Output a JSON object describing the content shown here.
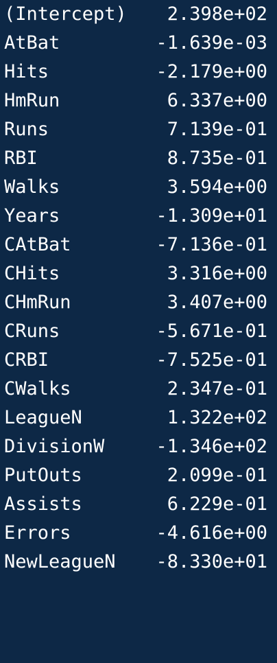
{
  "coefficients": [
    {
      "term": "(Intercept)",
      "value": "2.398e+02"
    },
    {
      "term": "AtBat",
      "value": "-1.639e-03"
    },
    {
      "term": "Hits",
      "value": "-2.179e+00"
    },
    {
      "term": "HmRun",
      "value": "6.337e+00"
    },
    {
      "term": "Runs",
      "value": "7.139e-01"
    },
    {
      "term": "RBI",
      "value": "8.735e-01"
    },
    {
      "term": "Walks",
      "value": "3.594e+00"
    },
    {
      "term": "Years",
      "value": "-1.309e+01"
    },
    {
      "term": "CAtBat",
      "value": "-7.136e-01"
    },
    {
      "term": "CHits",
      "value": "3.316e+00"
    },
    {
      "term": "CHmRun",
      "value": "3.407e+00"
    },
    {
      "term": "CRuns",
      "value": "-5.671e-01"
    },
    {
      "term": "CRBI",
      "value": "-7.525e-01"
    },
    {
      "term": "CWalks",
      "value": "2.347e-01"
    },
    {
      "term": "LeagueN",
      "value": "1.322e+02"
    },
    {
      "term": "DivisionW",
      "value": "-1.346e+02"
    },
    {
      "term": "PutOuts",
      "value": "2.099e-01"
    },
    {
      "term": "Assists",
      "value": "6.229e-01"
    },
    {
      "term": "Errors",
      "value": "-4.616e+00"
    },
    {
      "term": "NewLeagueN",
      "value": "-8.330e+01"
    }
  ]
}
